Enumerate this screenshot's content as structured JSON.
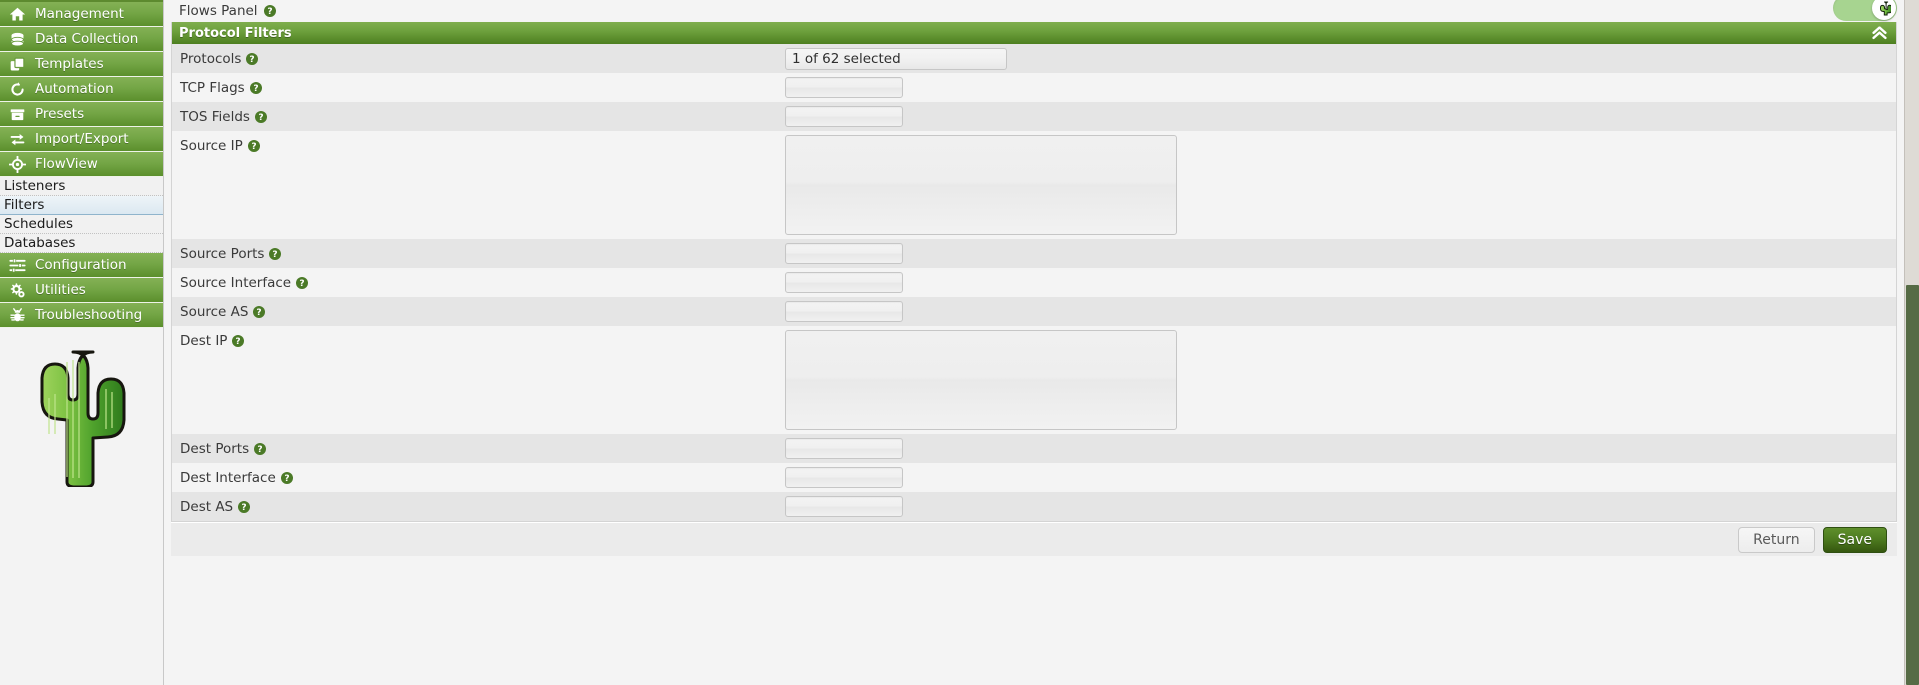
{
  "sidebar": {
    "nav": [
      {
        "label": "Management",
        "icon": "home-icon"
      },
      {
        "label": "Data Collection",
        "icon": "database-icon"
      },
      {
        "label": "Templates",
        "icon": "copy-icon"
      },
      {
        "label": "Automation",
        "icon": "refresh-icon"
      },
      {
        "label": "Presets",
        "icon": "archive-box-icon"
      },
      {
        "label": "Import/Export",
        "icon": "exchange-arrows-icon"
      },
      {
        "label": "FlowView",
        "icon": "target-crosshair-icon"
      }
    ],
    "sub_items": [
      {
        "label": "Listeners",
        "selected": false
      },
      {
        "label": "Filters",
        "selected": true
      },
      {
        "label": "Schedules",
        "selected": false
      },
      {
        "label": "Databases",
        "selected": false
      }
    ],
    "nav_bottom": [
      {
        "label": "Configuration",
        "icon": "sliders-icon"
      },
      {
        "label": "Utilities",
        "icon": "gears-icon"
      },
      {
        "label": "Troubleshooting",
        "icon": "bug-icon"
      }
    ],
    "logo_alt": "cactus-logo"
  },
  "topbar": {
    "flows_panel_label": "Flows Panel",
    "help_icon": "help-icon",
    "toggle_state": "on",
    "toggle_knob_icon": "cactus-icon"
  },
  "panel": {
    "title": "Protocol Filters",
    "collapse_icon": "double-chevron-up-icon",
    "rows": [
      {
        "label": "Protocols",
        "control": "select",
        "value": "1 of 62 selected",
        "help": "help-icon"
      },
      {
        "label": "TCP Flags",
        "control": "text",
        "value": "",
        "help": "help-icon"
      },
      {
        "label": "TOS Fields",
        "control": "text",
        "value": "",
        "help": "help-icon"
      },
      {
        "label": "Source IP",
        "control": "textarea",
        "value": "",
        "help": "help-icon"
      },
      {
        "label": "Source Ports",
        "control": "text",
        "value": "",
        "help": "help-icon"
      },
      {
        "label": "Source Interface",
        "control": "text",
        "value": "",
        "help": "help-icon"
      },
      {
        "label": "Source AS",
        "control": "text",
        "value": "",
        "help": "help-icon"
      },
      {
        "label": "Dest IP",
        "control": "textarea",
        "value": "",
        "help": "help-icon"
      },
      {
        "label": "Dest Ports",
        "control": "text",
        "value": "",
        "help": "help-icon"
      },
      {
        "label": "Dest Interface",
        "control": "text",
        "value": "",
        "help": "help-icon"
      },
      {
        "label": "Dest AS",
        "control": "text",
        "value": "",
        "help": "help-icon"
      }
    ]
  },
  "actions": {
    "return_label": "Return",
    "save_label": "Save"
  },
  "colors": {
    "nav_green": "#74a646",
    "header_green": "#6ea13d",
    "save_green": "#4e7c20",
    "toggle_on": "#a7d490",
    "row_odd": "#e5e5e5",
    "row_even": "#f4f4f4"
  }
}
